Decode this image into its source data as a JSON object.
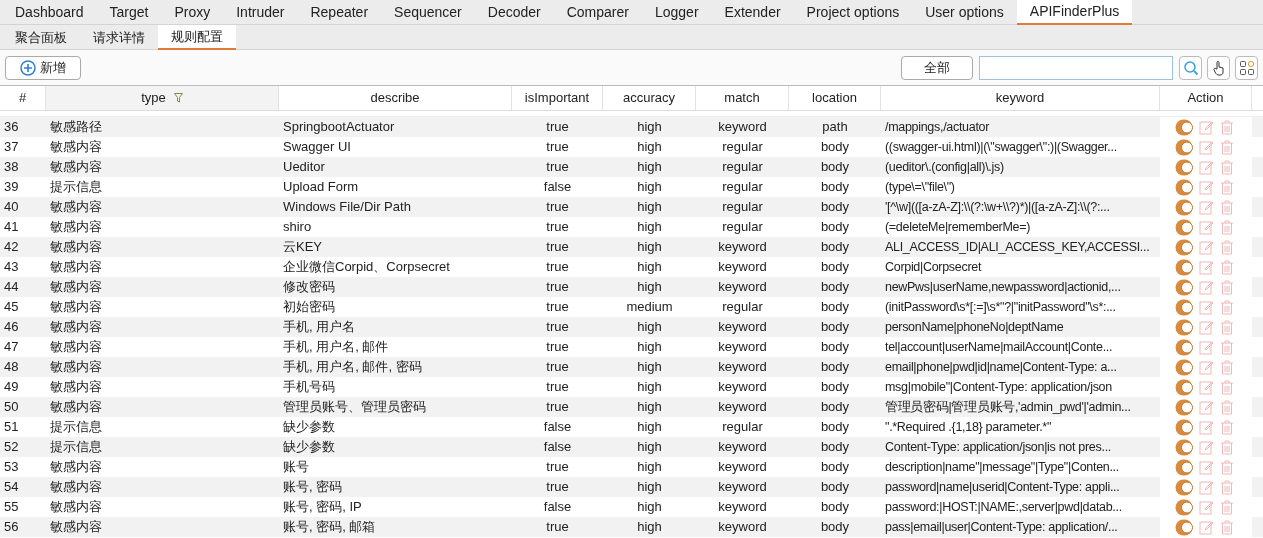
{
  "tabs": [
    {
      "label": "Dashboard",
      "selected": false
    },
    {
      "label": "Target",
      "selected": false
    },
    {
      "label": "Proxy",
      "selected": false
    },
    {
      "label": "Intruder",
      "selected": false
    },
    {
      "label": "Repeater",
      "selected": false
    },
    {
      "label": "Sequencer",
      "selected": false
    },
    {
      "label": "Decoder",
      "selected": false
    },
    {
      "label": "Comparer",
      "selected": false
    },
    {
      "label": "Logger",
      "selected": false
    },
    {
      "label": "Extender",
      "selected": false
    },
    {
      "label": "Project options",
      "selected": false
    },
    {
      "label": "User options",
      "selected": false
    },
    {
      "label": "APIFinderPlus",
      "selected": true
    }
  ],
  "sub_tabs": [
    {
      "label": "聚合面板",
      "selected": false
    },
    {
      "label": "请求详情",
      "selected": false
    },
    {
      "label": "规则配置",
      "selected": true
    }
  ],
  "toolbar": {
    "add_button": "新增",
    "scope_button": "全部"
  },
  "table": {
    "columns": [
      {
        "label": "#",
        "filter": false
      },
      {
        "label": "type",
        "filter": true
      },
      {
        "label": "describe",
        "filter": false
      },
      {
        "label": "isImportant",
        "filter": false
      },
      {
        "label": "accuracy",
        "filter": false
      },
      {
        "label": "match",
        "filter": false
      },
      {
        "label": "location",
        "filter": false
      },
      {
        "label": "keyword",
        "filter": false
      },
      {
        "label": "Action",
        "filter": false
      }
    ],
    "rows": [
      {
        "index": "36",
        "type": "敏感路径",
        "describe": "SpringbootActuator",
        "is_important": "true",
        "accuracy": "high",
        "match": "keyword",
        "location": "path",
        "keyword": "/mappings,/actuator",
        "enabled": true
      },
      {
        "index": "37",
        "type": "敏感内容",
        "describe": "Swagger UI",
        "is_important": "true",
        "accuracy": "high",
        "match": "regular",
        "location": "body",
        "keyword": "((swagger-ui.html)|(\\\"swagger\\\":)|(Swagger...",
        "enabled": true
      },
      {
        "index": "38",
        "type": "敏感内容",
        "describe": "Ueditor",
        "is_important": "true",
        "accuracy": "high",
        "match": "regular",
        "location": "body",
        "keyword": "(ueditor\\.(config|all)\\.js)",
        "enabled": true
      },
      {
        "index": "39",
        "type": "提示信息",
        "describe": "Upload Form",
        "is_important": "false",
        "accuracy": "high",
        "match": "regular",
        "location": "body",
        "keyword": "(type\\=\\\"file\\\")",
        "enabled": true
      },
      {
        "index": "40",
        "type": "敏感内容",
        "describe": "Windows File/Dir Path",
        "is_important": "true",
        "accuracy": "high",
        "match": "regular",
        "location": "body",
        "keyword": "'[^\\w](([a-zA-Z]:\\\\(?:\\w+\\\\?)*)|([a-zA-Z]:\\\\(?:...",
        "enabled": true
      },
      {
        "index": "41",
        "type": "敏感内容",
        "describe": "shiro",
        "is_important": "true",
        "accuracy": "high",
        "match": "regular",
        "location": "body",
        "keyword": "(=deleteMe|rememberMe=)",
        "enabled": true
      },
      {
        "index": "42",
        "type": "敏感内容",
        "describe": "云KEY",
        "is_important": "true",
        "accuracy": "high",
        "match": "keyword",
        "location": "body",
        "keyword": "ALI_ACCESS_ID|ALI_ACCESS_KEY,ACCESSI...",
        "enabled": true
      },
      {
        "index": "43",
        "type": "敏感内容",
        "describe": "企业微信Corpid、Corpsecret",
        "is_important": "true",
        "accuracy": "high",
        "match": "keyword",
        "location": "body",
        "keyword": "Corpid|Corpsecret",
        "enabled": true
      },
      {
        "index": "44",
        "type": "敏感内容",
        "describe": "修改密码",
        "is_important": "true",
        "accuracy": "high",
        "match": "keyword",
        "location": "body",
        "keyword": "newPws|userName,newpassword|actionid,...",
        "enabled": true
      },
      {
        "index": "45",
        "type": "敏感内容",
        "describe": "初始密码",
        "is_important": "true",
        "accuracy": "medium",
        "match": "regular",
        "location": "body",
        "keyword": "(initPassword\\s*[:=]\\s*\"?|\"initPassword\"\\s*:...",
        "enabled": true
      },
      {
        "index": "46",
        "type": "敏感内容",
        "describe": "手机, 用户名",
        "is_important": "true",
        "accuracy": "high",
        "match": "keyword",
        "location": "body",
        "keyword": "personName|phoneNo|deptName",
        "enabled": true
      },
      {
        "index": "47",
        "type": "敏感内容",
        "describe": "手机, 用户名, 邮件",
        "is_important": "true",
        "accuracy": "high",
        "match": "keyword",
        "location": "body",
        "keyword": "tel|account|userName|mailAccount|Conte...",
        "enabled": true
      },
      {
        "index": "48",
        "type": "敏感内容",
        "describe": "手机, 用户名, 邮件, 密码",
        "is_important": "true",
        "accuracy": "high",
        "match": "keyword",
        "location": "body",
        "keyword": "email|phone|pwd|id|name|Content-Type: a...",
        "enabled": true
      },
      {
        "index": "49",
        "type": "敏感内容",
        "describe": "手机号码",
        "is_important": "true",
        "accuracy": "high",
        "match": "keyword",
        "location": "body",
        "keyword": "msg|mobile\"|Content-Type: application/json",
        "enabled": true
      },
      {
        "index": "50",
        "type": "敏感内容",
        "describe": "管理员账号、管理员密码",
        "is_important": "true",
        "accuracy": "high",
        "match": "keyword",
        "location": "body",
        "keyword": "管理员密码|管理员账号,'admin_pwd'|'admin...",
        "enabled": true
      },
      {
        "index": "51",
        "type": "提示信息",
        "describe": "缺少参数",
        "is_important": "false",
        "accuracy": "high",
        "match": "regular",
        "location": "body",
        "keyword": "\".*Required .{1,18} parameter.*\"",
        "enabled": true
      },
      {
        "index": "52",
        "type": "提示信息",
        "describe": "缺少参数",
        "is_important": "false",
        "accuracy": "high",
        "match": "keyword",
        "location": "body",
        "keyword": "Content-Type: application/json|is not pres...",
        "enabled": true
      },
      {
        "index": "53",
        "type": "敏感内容",
        "describe": "账号",
        "is_important": "true",
        "accuracy": "high",
        "match": "keyword",
        "location": "body",
        "keyword": "description|name\"|message\"|Type\"|Conten...",
        "enabled": true
      },
      {
        "index": "54",
        "type": "敏感内容",
        "describe": "账号, 密码",
        "is_important": "true",
        "accuracy": "high",
        "match": "keyword",
        "location": "body",
        "keyword": "password|name|userid|Content-Type: appli...",
        "enabled": true
      },
      {
        "index": "55",
        "type": "敏感内容",
        "describe": "账号, 密码, IP",
        "is_important": "false",
        "accuracy": "high",
        "match": "keyword",
        "location": "body",
        "keyword": "password:|HOST:|NAME:,server|pwd|datab...",
        "enabled": true
      },
      {
        "index": "56",
        "type": "敏感内容",
        "describe": "账号, 密码, 邮箱",
        "is_important": "true",
        "accuracy": "high",
        "match": "keyword",
        "location": "body",
        "keyword": "pass|email|user|Content-Type: application/...",
        "enabled": true
      }
    ]
  }
}
